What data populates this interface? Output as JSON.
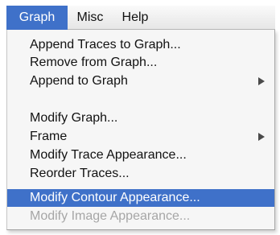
{
  "menubar": {
    "items": [
      {
        "label": "Graph",
        "active": true
      },
      {
        "label": "Misc",
        "active": false
      },
      {
        "label": "Help",
        "active": false
      }
    ]
  },
  "menu": {
    "items": [
      {
        "label": "Append Traces to Graph...",
        "has_submenu": false,
        "enabled": true,
        "selected": false
      },
      {
        "label": "Remove from Graph...",
        "has_submenu": false,
        "enabled": true,
        "selected": false
      },
      {
        "label": "Append to Graph",
        "has_submenu": true,
        "enabled": true,
        "selected": false
      },
      {
        "label": "Modify Graph...",
        "has_submenu": false,
        "enabled": true,
        "selected": false
      },
      {
        "label": "Frame",
        "has_submenu": true,
        "enabled": true,
        "selected": false
      },
      {
        "label": "Modify Trace Appearance...",
        "has_submenu": false,
        "enabled": true,
        "selected": false
      },
      {
        "label": "Reorder Traces...",
        "has_submenu": false,
        "enabled": true,
        "selected": false
      },
      {
        "label": "Modify Contour Appearance...",
        "has_submenu": false,
        "enabled": true,
        "selected": true
      },
      {
        "label": "Modify Image Appearance...",
        "has_submenu": false,
        "enabled": false,
        "selected": false
      }
    ]
  },
  "colors": {
    "highlight": "#3f71c9",
    "disabled_text": "#a6a6a6"
  },
  "icons": {
    "submenu_arrow": "submenu-arrow-icon"
  }
}
